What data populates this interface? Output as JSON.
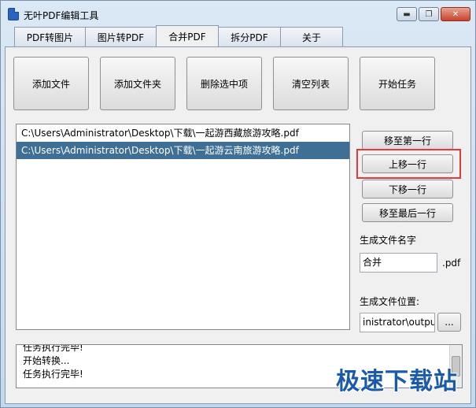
{
  "window": {
    "title": "无叶PDF编辑工具",
    "min_icon": "minimize-icon",
    "max_icon": "maximize-icon",
    "close_icon": "close-icon",
    "close_glyph": "✕",
    "min_glyph": "▬",
    "max_glyph": "❐"
  },
  "tabs": [
    "PDF转图片",
    "图片转PDF",
    "合并PDF",
    "拆分PDF",
    "关于"
  ],
  "active_tab": "合并PDF",
  "toolbar": {
    "add_file": "添加文件",
    "add_folder": "添加文件夹",
    "delete_selected": "删除选中项",
    "clear_list": "清空列表",
    "start_task": "开始任务"
  },
  "files": [
    "C:\\Users\\Administrator\\Desktop\\下载\\一起游西藏旅游攻略.pdf",
    "C:\\Users\\Administrator\\Desktop\\下载\\一起游云南旅游攻略.pdf"
  ],
  "selected_file_index": 1,
  "side_buttons": {
    "move_top": "移至第一行",
    "move_up": "上移一行",
    "move_down": "下移一行",
    "move_bottom": "移至最后一行"
  },
  "output": {
    "name_label": "生成文件名字",
    "name_value": "合并",
    "suffix": ".pdf",
    "location_label": "生成文件位置:",
    "location_value": "inistrator\\output",
    "browse_label": "..."
  },
  "log": [
    "任务执行完毕!",
    "开始转换...",
    "任务执行完毕!"
  ],
  "watermark": "极速下载站",
  "colors": {
    "selection": "#3f6f94",
    "highlight_border": "#e03a3a",
    "watermark": "#1b5aa8"
  }
}
